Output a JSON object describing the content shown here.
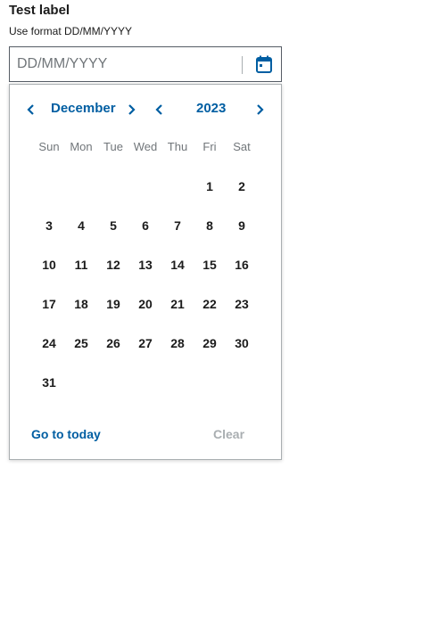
{
  "field": {
    "label": "Test label",
    "hint": "Use format DD/MM/YYYY",
    "value": "",
    "placeholder": "DD/MM/YYYY"
  },
  "calendar": {
    "month": "December",
    "year": "2023",
    "weekdays": [
      "Sun",
      "Mon",
      "Tue",
      "Wed",
      "Thu",
      "Fri",
      "Sat"
    ],
    "weeks": [
      [
        "",
        "",
        "",
        "",
        "",
        "1",
        "2"
      ],
      [
        "3",
        "4",
        "5",
        "6",
        "7",
        "8",
        "9"
      ],
      [
        "10",
        "11",
        "12",
        "13",
        "14",
        "15",
        "16"
      ],
      [
        "17",
        "18",
        "19",
        "20",
        "21",
        "22",
        "23"
      ],
      [
        "24",
        "25",
        "26",
        "27",
        "28",
        "29",
        "30"
      ],
      [
        "31",
        "",
        "",
        "",
        "",
        "",
        ""
      ]
    ],
    "go_to_today_label": "Go to today",
    "clear_label": "Clear"
  },
  "colors": {
    "accent": "#005ea2",
    "text": "#1b1b1b",
    "muted": "#71767a",
    "disabled": "#a9aeb1"
  },
  "icons": {
    "toggle": "calendar-icon",
    "prev": "chevron-left-icon",
    "next": "chevron-right-icon"
  }
}
